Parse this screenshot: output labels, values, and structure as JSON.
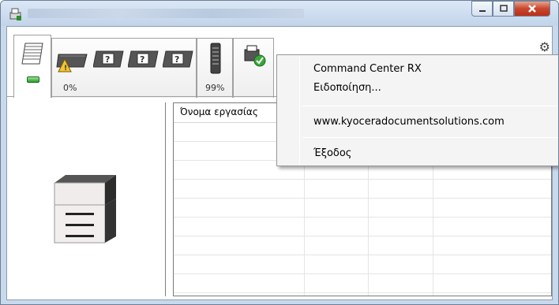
{
  "window": {
    "title": ""
  },
  "titlebar_buttons": {
    "minimize": "–",
    "maximize": "□",
    "close": "✕"
  },
  "tabs": {
    "toner": {
      "percent": "0%"
    },
    "paper": {
      "percent": "99%"
    }
  },
  "job_list": {
    "columns": [
      "Όνομα εργασίας"
    ]
  },
  "context_menu": {
    "items": [
      "Command Center RX",
      "Ειδοποίηση...",
      "www.kyoceradocumentsolutions.com",
      "Έξοδος"
    ]
  },
  "icons": {
    "app": "printer-app-icon",
    "settings": "gear-icon",
    "status_indicator": "green-led-icon"
  }
}
